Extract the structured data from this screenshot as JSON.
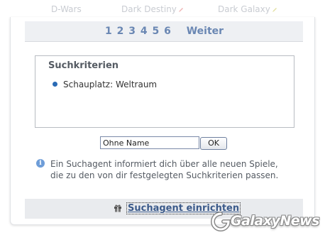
{
  "top_tabs": [
    "D-Wars",
    "Dark Destiny",
    "Dark Galaxy"
  ],
  "pager": {
    "pages": [
      "1",
      "2",
      "3",
      "4",
      "5",
      "6"
    ],
    "next_label": "Weiter"
  },
  "criteria": {
    "title": "Suchkriterien",
    "items": [
      "Schauplatz: Weltraum"
    ]
  },
  "search_form": {
    "name_value": "Ohne Name",
    "ok_label": "OK"
  },
  "info": {
    "lines": [
      "Ein Suchagent informiert dich über alle neuen Spiele,",
      "die zu den von dir festgelegten Suchkriterien passen."
    ]
  },
  "action": {
    "label": "Suchagent einrichten",
    "icon": "gift-icon"
  },
  "watermark": {
    "text": "GalaxyNews"
  },
  "colors": {
    "accent": "#6a87b3",
    "link": "#3b5a8a",
    "bullet": "#2a6bb5",
    "info_icon": "#6e9dd8"
  }
}
